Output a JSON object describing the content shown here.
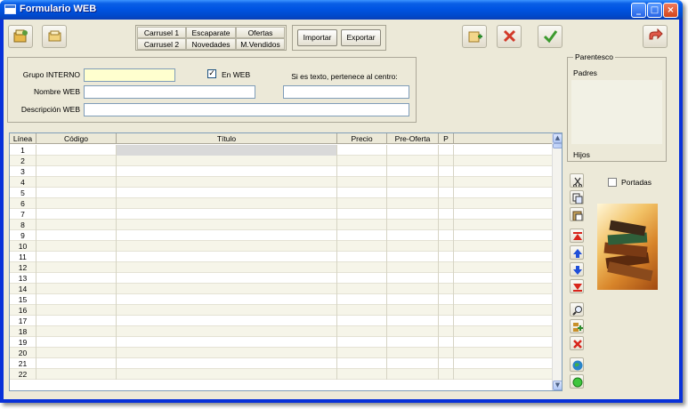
{
  "window": {
    "title": "Formulario WEB",
    "minimize": "_",
    "maximize": "□",
    "close": "×"
  },
  "toolbar": {
    "left_icons": [
      "new-record-icon",
      "open-icon"
    ],
    "right_icons": [
      "add-page-icon",
      "delete-icon",
      "accept-icon",
      "exit-icon"
    ]
  },
  "tabs": {
    "row1": [
      "Carrusel 1",
      "Escaparate",
      "Ofertas"
    ],
    "row2": [
      "Carrusel 2",
      "Novedades",
      "M.Vendidos"
    ]
  },
  "actions": {
    "import_label": "Importar",
    "export_label": "Exportar"
  },
  "form": {
    "grupo_label": "Grupo INTERNO",
    "grupo_value": "",
    "en_web_label": "En WEB",
    "en_web_checked": "✓",
    "nombre_label": "Nombre WEB",
    "nombre_value": "",
    "descripcion_label": "Descripción WEB",
    "descripcion_value": "",
    "centro_label": "Si es texto, pertenece al centro:",
    "centro_value": ""
  },
  "parentesco": {
    "title": "Parentesco",
    "padres_label": "Padres",
    "hijos_label": "Hijos"
  },
  "portadas": {
    "label": "Portadas",
    "checked": ""
  },
  "grid": {
    "columns": [
      "Línea",
      "Código",
      "Título",
      "Precio",
      "Pre-Oferta",
      "P",
      ""
    ],
    "rows": [
      "1",
      "2",
      "3",
      "4",
      "5",
      "6",
      "7",
      "8",
      "9",
      "10",
      "11",
      "12",
      "13",
      "14",
      "15",
      "16",
      "17",
      "18",
      "19",
      "20",
      "21",
      "22"
    ]
  },
  "side_tools": [
    "cut-icon",
    "copy-icon",
    "paste-icon",
    "move-top-icon",
    "move-up-icon",
    "move-down-icon",
    "move-bottom-icon",
    "search-icon",
    "insert-row-icon",
    "delete-row-icon",
    "globe-icon",
    "green-dot-icon"
  ],
  "scroll": {
    "up": "▲",
    "down": "▼"
  },
  "colors": {
    "titlebar": "#0054e3",
    "client": "#ece9d8",
    "row_alt": "#f6f5e9",
    "yellow_input": "#ffffcf"
  }
}
